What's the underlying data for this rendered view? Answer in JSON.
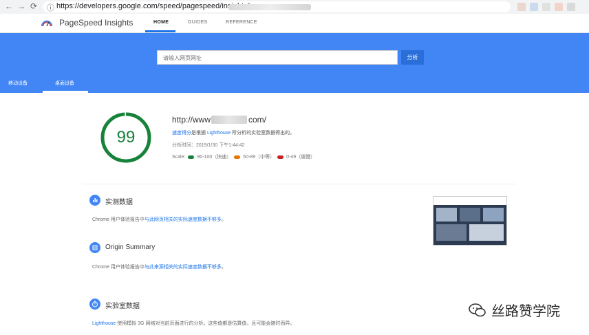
{
  "browser": {
    "url": "https://developers.google.com/speed/pagespeed/insights/",
    "info_icon": "info-icon",
    "back_icon": "back-arrow-icon",
    "forward_icon": "forward-arrow-icon",
    "reload_icon": "reload-icon"
  },
  "header": {
    "brand": "PageSpeed Insights",
    "tabs": [
      {
        "label": "HOME",
        "active": true
      },
      {
        "label": "GUIDES",
        "active": false
      },
      {
        "label": "REFERENCE",
        "active": false
      }
    ]
  },
  "hero": {
    "search_placeholder": "请输入网页网址",
    "analyze_label": "分析",
    "device_tabs": [
      {
        "label": "移动设备",
        "active": false
      },
      {
        "label": "桌面设备",
        "active": true
      }
    ]
  },
  "result": {
    "score": "99",
    "score_fraction": 0.99,
    "url_prefix": "http://www",
    "url_suffix": "com/",
    "desc_link": "速度得分",
    "desc_mid": "是根据",
    "desc_lighthouse": "Lighthouse",
    "desc_tail": "所分析的实验室数据得出的。",
    "time": "分析时间：2019/1/30 下午1:44:42",
    "scale_label": "Scale:",
    "scale": [
      {
        "label": "90-100（快速）",
        "color": "#178239"
      },
      {
        "label": "50-89（中等）",
        "color": "#e67700"
      },
      {
        "label": "0-49（缓慢）",
        "color": "#c7221f"
      }
    ]
  },
  "sections": {
    "field": {
      "title": "实测数据",
      "icon": "bar-chart-icon",
      "body_prefix": "Chrome 用户体验报告中",
      "body_link": "与此网页相关的实际速度数据不够多",
      "body_suffix": "。"
    },
    "origin": {
      "title": "Origin Summary",
      "icon": "list-icon",
      "body_prefix": "Chrome 用户体验报告中",
      "body_link": "与此来源相关的实际速度数据不够多",
      "body_suffix": "。"
    },
    "lab": {
      "title": "实验室数据",
      "icon": "stopwatch-icon",
      "body_link": "Lighthouse",
      "body_rest": " 使用模拟 3G 网络对当前页面进行的分析。这些值都是估算值，且可能会随时而异。"
    }
  },
  "watermark": {
    "text": "丝路赞学院",
    "icon": "wechat-icon"
  }
}
